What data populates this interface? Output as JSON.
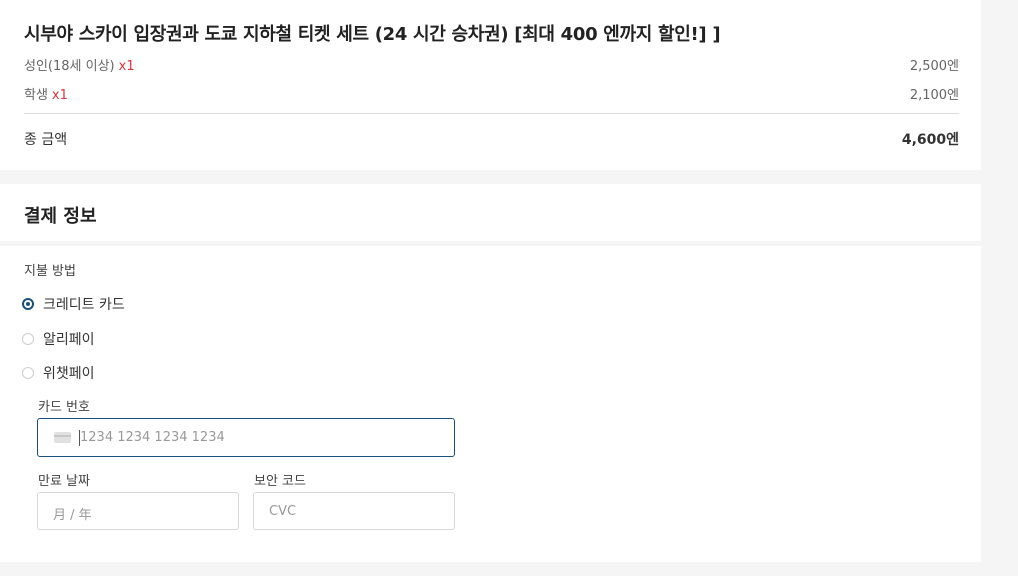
{
  "order": {
    "title": "시부야 스카이 입장권과 도쿄 지하철 티켓 세트 (24 시간 승차권) [최대 400 엔까지 할인!] ]",
    "items": [
      {
        "label": "성인(18세 이상)",
        "qty": "x1",
        "price": "2,500엔"
      },
      {
        "label": "학생",
        "qty": "x1",
        "price": "2,100엔"
      }
    ],
    "total_label": "종 금액",
    "total_amount": "4,600엔"
  },
  "payment": {
    "title": "결제 정보",
    "method_label": "지불 방법",
    "methods": [
      {
        "label": "크레디트 카드",
        "selected": true
      },
      {
        "label": "알리페이",
        "selected": false
      },
      {
        "label": "위챗페이",
        "selected": false
      }
    ],
    "card_number_label": "카드 번호",
    "card_number_placeholder": "1234 1234 1234 1234",
    "expiry_label": "만료 날짜",
    "expiry_placeholder": "月 / 年",
    "cvc_label": "보안 코드",
    "cvc_placeholder": "CVC"
  },
  "colors": {
    "accent": "#1b4e7a",
    "qty_red": "#d3393e",
    "background": "#f5f5f5"
  },
  "icons": {
    "card": "credit-card-icon"
  }
}
